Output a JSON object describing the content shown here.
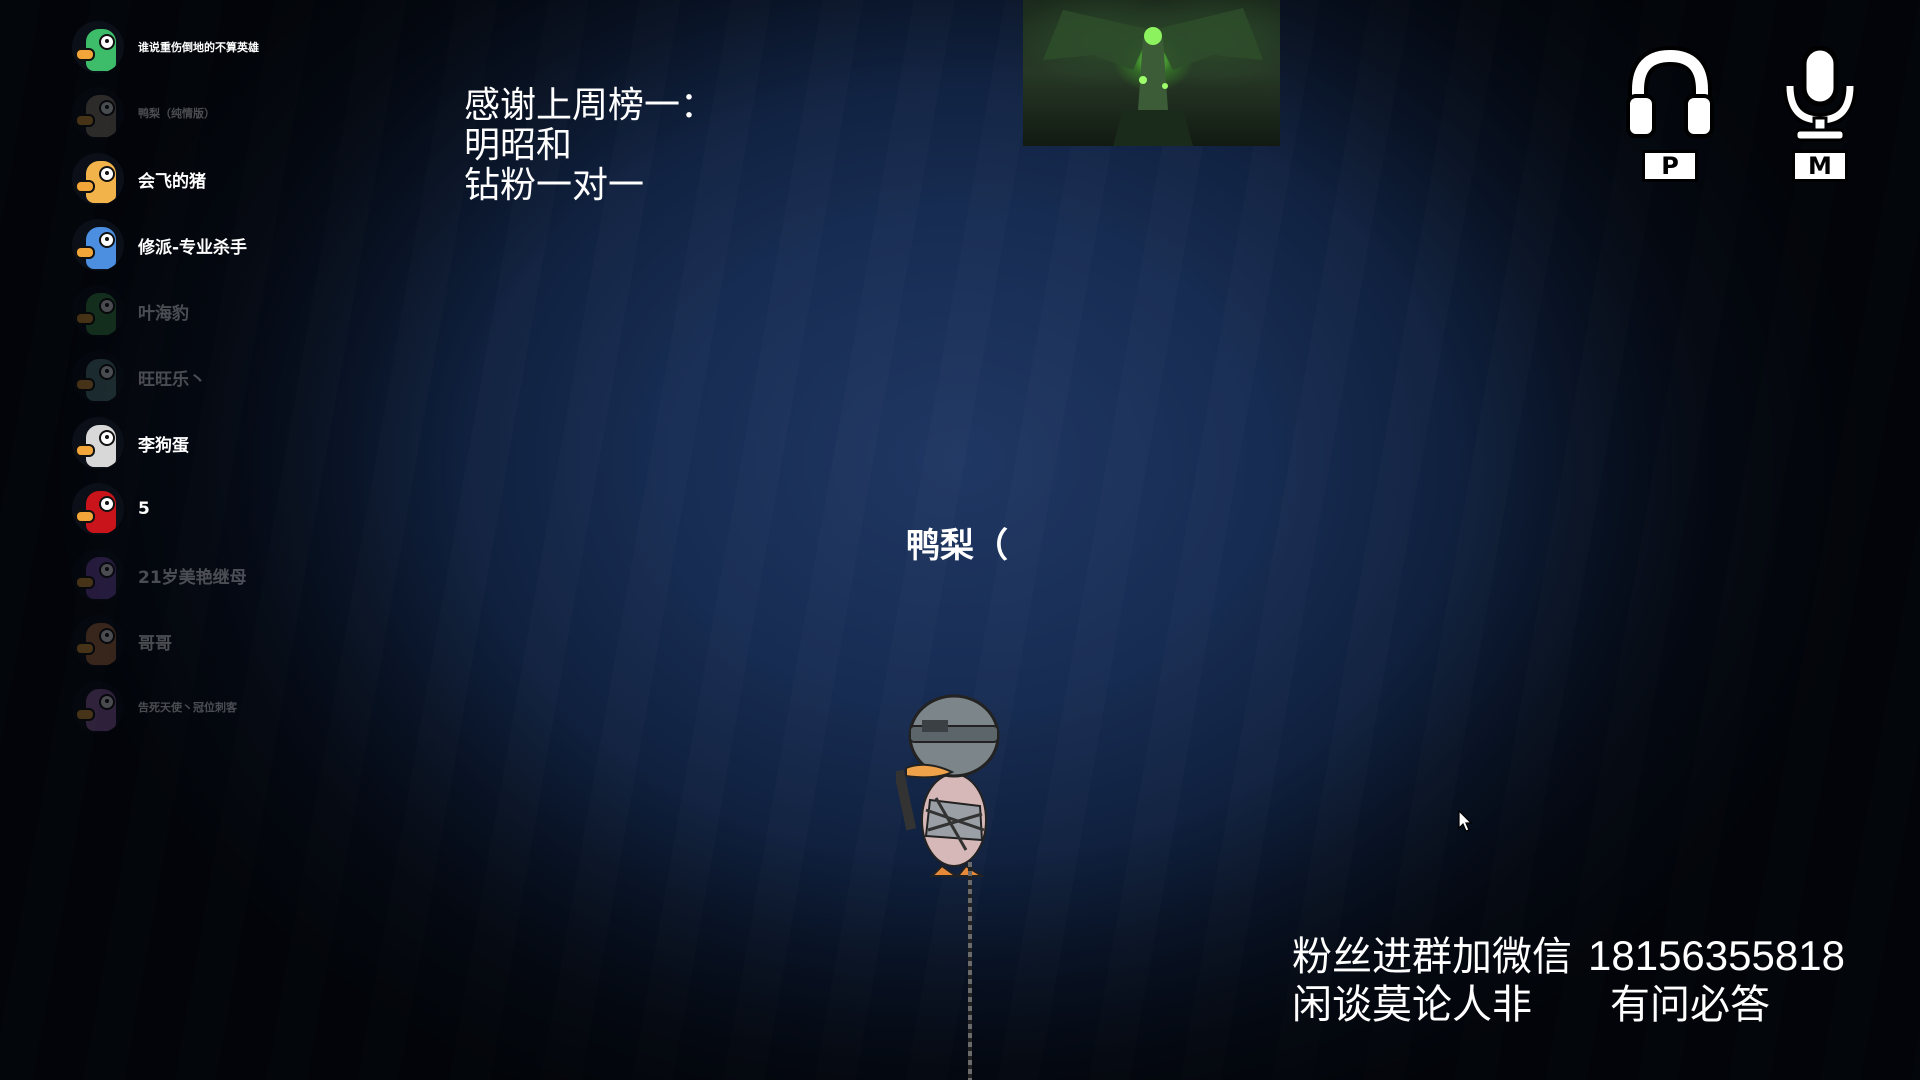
{
  "players": [
    {
      "name": "谁说重伤倒地的不算英雄",
      "color": "#3dbd6a",
      "active": true,
      "small": true
    },
    {
      "name": "鸭梨（纯情版）",
      "color": "#9a8a7e",
      "active": false,
      "small": true
    },
    {
      "name": "会飞的猪",
      "color": "#f2b44a",
      "active": true,
      "small": false
    },
    {
      "name": "修派-专业杀手",
      "color": "#4c8fe0",
      "active": true,
      "small": false
    },
    {
      "name": "叶海豹",
      "color": "#3f9a4a",
      "active": false,
      "small": false
    },
    {
      "name": "旺旺乐丶",
      "color": "#5a8a8a",
      "active": false,
      "small": false
    },
    {
      "name": "李狗蛋",
      "color": "#d8d8d8",
      "active": true,
      "small": false
    },
    {
      "name": "5",
      "color": "#c8141a",
      "active": true,
      "small": false
    },
    {
      "name": "21岁美艳继母",
      "color": "#7a4fb8",
      "active": false,
      "small": false
    },
    {
      "name": "哥哥",
      "color": "#c07848",
      "active": false,
      "small": false
    },
    {
      "name": "告死天使丶冠位刺客",
      "color": "#a06ab8",
      "active": false,
      "small": true
    }
  ],
  "thanks": {
    "line1": "感谢上周榜一：",
    "line2": "明昭和",
    "line3": "钻粉一对一"
  },
  "hud": {
    "headset_key": "P",
    "mic_key": "M"
  },
  "center_name": "鸭梨（",
  "bottom": {
    "line1_text": "粉丝进群加微信",
    "phone": "18156355818",
    "line2_left": "闲谈莫论人非",
    "line2_right": "有问必答"
  }
}
